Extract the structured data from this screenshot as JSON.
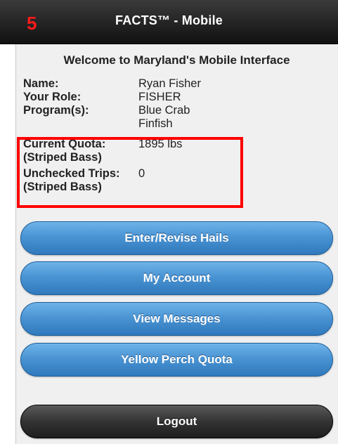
{
  "header": {
    "title": "FACTS™ - Mobile",
    "step_badge": "5"
  },
  "welcome": "Welcome to Maryland's Mobile Interface",
  "profile": {
    "name_label": "Name:",
    "name_value": "Ryan Fisher",
    "role_label": "Your Role:",
    "role_value": "FISHER",
    "programs_label": "Program(s):",
    "programs": [
      "Blue Crab",
      "Finfish"
    ]
  },
  "quota": {
    "current_quota_label": "Current Quota:",
    "current_quota_sub": "(Striped Bass)",
    "current_quota_value": "1895 lbs",
    "unchecked_trips_label": "Unchecked Trips:",
    "unchecked_trips_sub": "(Striped Bass)",
    "unchecked_trips_value": "0"
  },
  "buttons": {
    "enter_revise_hails": "Enter/Revise Hails",
    "my_account": "My Account",
    "view_messages": "View Messages",
    "yellow_perch_quota": "Yellow Perch Quota",
    "logout": "Logout"
  },
  "colors": {
    "highlight": "#ff0000",
    "button_blue": "#4a94d3",
    "button_dark": "#333333"
  }
}
